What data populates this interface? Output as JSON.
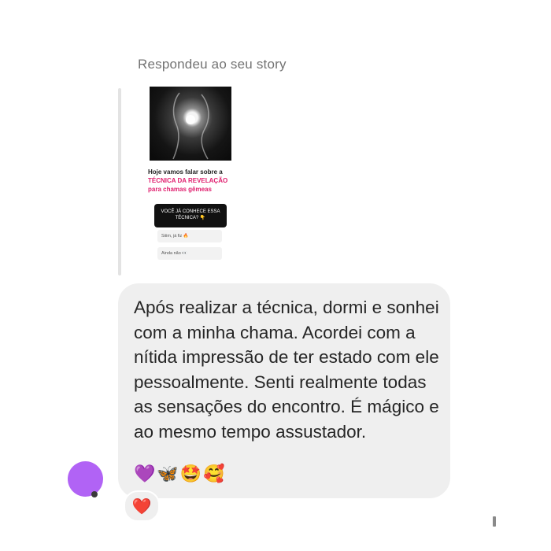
{
  "header": {
    "reply_label": "Respondeu ao seu story"
  },
  "story": {
    "line1": "Hoje vamos falar sobre a",
    "line2": "TÉCNICA DA REVELAÇÃO",
    "line3": "para chamas gêmeas",
    "poll_question": "VOCÊ JÁ CONHECE ESSA TÉCNICA? 👇",
    "poll_options": [
      "Siiim, já fiz 🔥",
      "Ainda não 👀"
    ]
  },
  "message": {
    "text": "Após realizar a técnica, dormi e sonhei com a minha chama. Acordei com a nítida impressão de ter estado com ele pessoalmente. Senti realmente todas as sensações do encontro. É mágico e ao mesmo tempo assustador.",
    "emojis": [
      "💜",
      "🦋",
      "🤩",
      "🥰"
    ]
  },
  "reaction": {
    "emoji": "❤️"
  },
  "colors": {
    "bubble": "#efefef",
    "avatar": "#b163f5",
    "accent_pink": "#e0206f",
    "reaction": "#e0113c"
  }
}
